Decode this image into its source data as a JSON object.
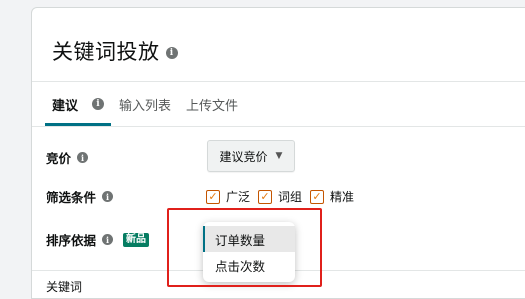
{
  "header": {
    "title": "关键词投放"
  },
  "tabs": [
    {
      "label": "建议",
      "active": true
    },
    {
      "label": "输入列表",
      "active": false
    },
    {
      "label": "上传文件",
      "active": false
    }
  ],
  "form": {
    "bid": {
      "label": "竞价",
      "button_label": "建议竞价"
    },
    "filter": {
      "label": "筛选条件",
      "options": [
        {
          "label": "广泛",
          "checked": true
        },
        {
          "label": "词组",
          "checked": true
        },
        {
          "label": "精准",
          "checked": true
        }
      ]
    },
    "sort": {
      "label": "排序依据",
      "badge": "新品",
      "dropdown_options": [
        {
          "label": "订单数量",
          "selected": true
        },
        {
          "label": "点击次数",
          "selected": false
        }
      ]
    }
  },
  "table": {
    "keyword_header": "关键词"
  },
  "colors": {
    "accent": "#007185",
    "checkbox": "#e47911",
    "badge": "#067d62",
    "highlight": "#e0201b"
  }
}
